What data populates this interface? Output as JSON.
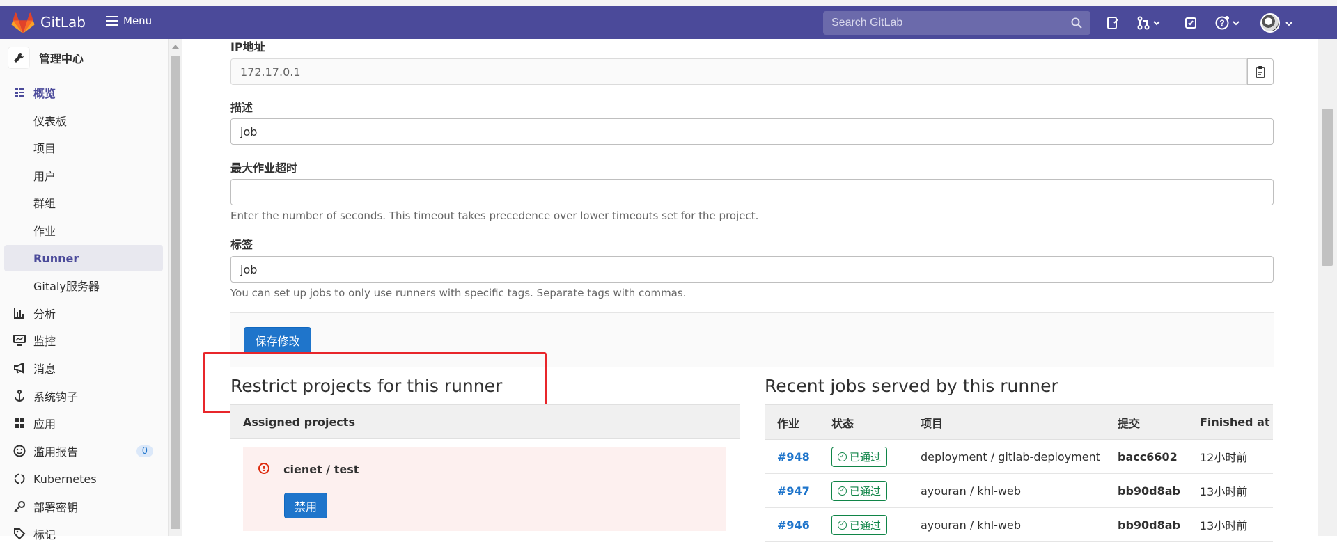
{
  "navbar": {
    "brand": "GitLab",
    "menu_label": "Menu",
    "search_placeholder": "Search GitLab",
    "icons": [
      "search-icon",
      "snippet-icon",
      "merge-request-icon",
      "todo-icon",
      "help-icon",
      "avatar"
    ]
  },
  "sidebar": {
    "header": "管理中心",
    "items": [
      {
        "label": "概览",
        "icon": "overview-icon"
      },
      {
        "label": "仪表板"
      },
      {
        "label": "项目"
      },
      {
        "label": "用户"
      },
      {
        "label": "群组"
      },
      {
        "label": "作业"
      },
      {
        "label": "Runner"
      },
      {
        "label": "Gitaly服务器"
      },
      {
        "label": "分析",
        "icon": "analytics-icon"
      },
      {
        "label": "监控",
        "icon": "monitor-icon"
      },
      {
        "label": "消息",
        "icon": "bullhorn-icon"
      },
      {
        "label": "系统钩子",
        "icon": "hook-icon"
      },
      {
        "label": "应用",
        "icon": "apps-icon"
      },
      {
        "label": "滥用报告",
        "icon": "smiley-icon",
        "badge": "0"
      },
      {
        "label": "Kubernetes",
        "icon": "kubernetes-icon"
      },
      {
        "label": "部署密钥",
        "icon": "key-icon"
      },
      {
        "label": "标记",
        "icon": "label-icon"
      }
    ]
  },
  "form": {
    "ip_label": "IP地址",
    "ip_value": "172.17.0.1",
    "desc_label": "描述",
    "desc_value": "job",
    "timeout_label": "最大作业超时",
    "timeout_value": "",
    "timeout_help": "Enter the number of seconds. This timeout takes precedence over lower timeouts set for the project.",
    "tags_label": "标签",
    "tags_value": "job",
    "tags_help": "You can set up jobs to only use runners with specific tags. Separate tags with commas.",
    "save_label": "保存修改"
  },
  "restrict": {
    "title": "Restrict projects for this runner",
    "assigned_header": "Assigned projects",
    "project_name": "cienet / test",
    "disable_label": "禁用"
  },
  "jobs": {
    "title": "Recent jobs served by this runner",
    "columns": [
      "作业",
      "状态",
      "项目",
      "提交",
      "Finished at"
    ],
    "rows": [
      {
        "id": "#948",
        "status": "已通过",
        "project": "deployment / gitlab-deployment",
        "commit": "bacc6602",
        "finished": "12小时前"
      },
      {
        "id": "#947",
        "status": "已通过",
        "project": "ayouran / khl-web",
        "commit": "bb90d8ab",
        "finished": "13小时前"
      },
      {
        "id": "#946",
        "status": "已通过",
        "project": "ayouran / khl-web",
        "commit": "bb90d8ab",
        "finished": "13小时前"
      }
    ]
  },
  "colors": {
    "navbar": "#4b4a9a",
    "primary": "#1f75cb",
    "success": "#108548",
    "highlight": "#e8262b"
  }
}
